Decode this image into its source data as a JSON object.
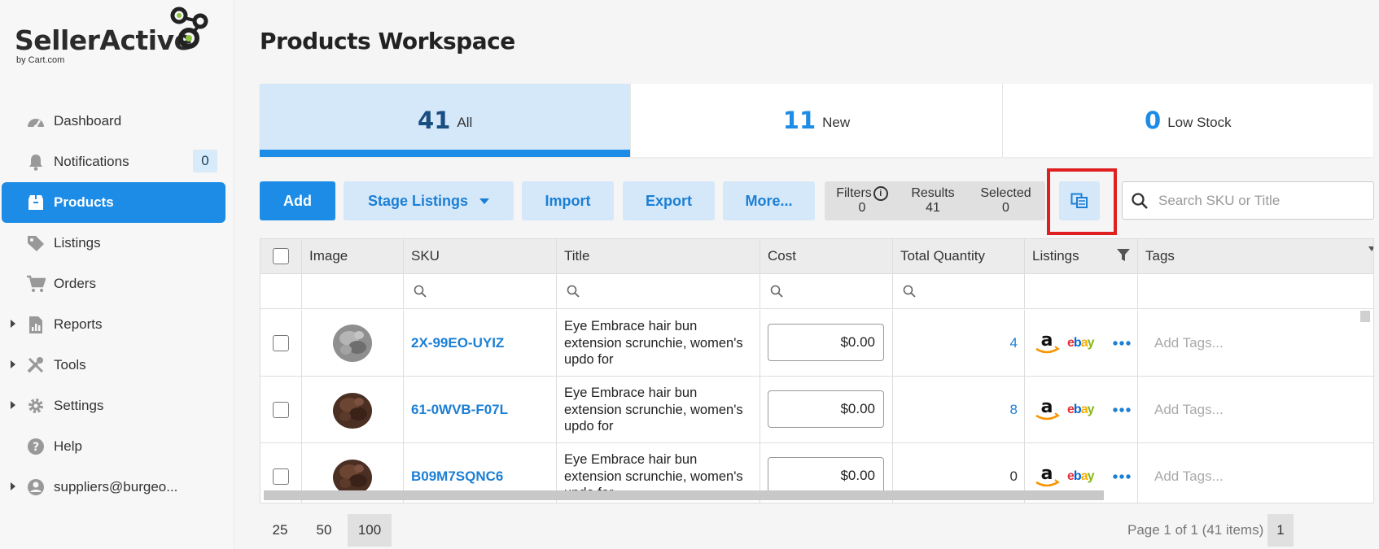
{
  "brand": {
    "name": "SellerActive",
    "sub": "by Cart.com"
  },
  "page": {
    "title": "Products Workspace"
  },
  "sidebar": {
    "items": [
      {
        "label": "Dashboard"
      },
      {
        "label": "Notifications",
        "badge": "0"
      },
      {
        "label": "Products"
      },
      {
        "label": "Listings"
      },
      {
        "label": "Orders"
      },
      {
        "label": "Reports"
      },
      {
        "label": "Tools"
      },
      {
        "label": "Settings"
      },
      {
        "label": "Help"
      },
      {
        "label": "suppliers@burgeo..."
      }
    ]
  },
  "tabs": [
    {
      "count": "41",
      "label": "All"
    },
    {
      "count": "11",
      "label": "New"
    },
    {
      "count": "0",
      "label": "Low Stock"
    }
  ],
  "toolbar": {
    "add": "Add",
    "stage": "Stage Listings",
    "import": "Import",
    "export": "Export",
    "more": "More...",
    "filters_label": "Filters",
    "filters_value": "0",
    "results_label": "Results",
    "results_value": "41",
    "selected_label": "Selected",
    "selected_value": "0",
    "search_placeholder": "Search SKU or Title"
  },
  "grid": {
    "columns": [
      "Image",
      "SKU",
      "Title",
      "Cost",
      "Total Quantity",
      "Listings",
      "Tags"
    ],
    "rows": [
      {
        "sku": "2X-99EO-UYIZ",
        "title": "Eye Embrace hair bun extension scrunchie, women's updo for",
        "cost": "$0.00",
        "qty": "4",
        "tags": "Add Tags..."
      },
      {
        "sku": "61-0WVB-F07L",
        "title": "Eye Embrace hair bun extension scrunchie, women's updo for",
        "cost": "$0.00",
        "qty": "8",
        "tags": "Add Tags..."
      },
      {
        "sku": "B09M7SQNC6",
        "title": "Eye Embrace hair bun extension scrunchie, women's updo for",
        "cost": "$0.00",
        "qty": "0",
        "tags": "Add Tags..."
      }
    ],
    "ebay": {
      "e": "e",
      "b": "b",
      "a": "a",
      "y": "y"
    }
  },
  "pagination": {
    "sizes": [
      "25",
      "50",
      "100"
    ],
    "info": "Page 1 of 1 (41 items)",
    "page": "1"
  },
  "colors": {
    "accent": "#1c8ce6",
    "accent_light": "#d4e8fa",
    "highlight": "#e02020"
  }
}
